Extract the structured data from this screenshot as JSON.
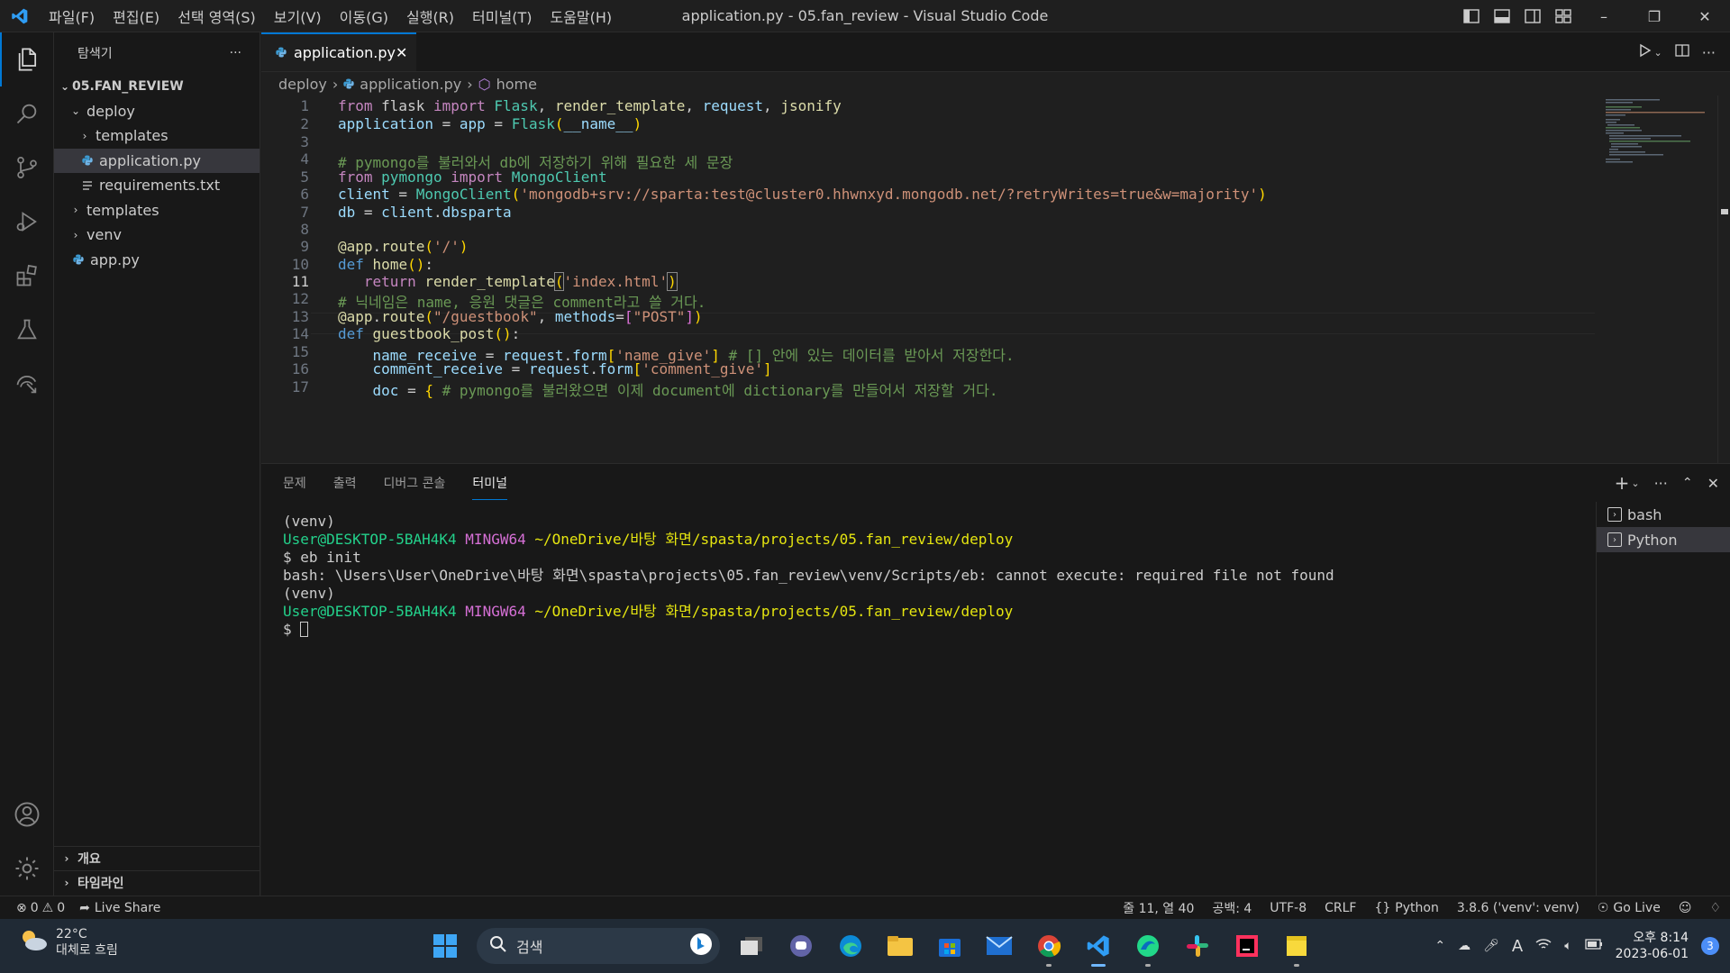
{
  "window": {
    "title": "application.py - 05.fan_review - Visual Studio Code",
    "menu": [
      "파일(F)",
      "편집(E)",
      "선택 영역(S)",
      "보기(V)",
      "이동(G)",
      "실행(R)",
      "터미널(T)",
      "도움말(H)"
    ]
  },
  "sidebar": {
    "header": "탐색기",
    "more": "···",
    "tree": [
      {
        "label": "05.FAN_REVIEW",
        "chev": "⌄",
        "icon": ""
      },
      {
        "label": "deploy",
        "chev": "⌄",
        "icon": ""
      },
      {
        "label": "templates",
        "chev": "›",
        "icon": ""
      },
      {
        "label": "application.py",
        "chev": "",
        "icon": "python-file-icon"
      },
      {
        "label": "requirements.txt",
        "chev": "",
        "icon": "text-file-icon"
      },
      {
        "label": "templates",
        "chev": "›",
        "icon": ""
      },
      {
        "label": "venv",
        "chev": "›",
        "icon": ""
      },
      {
        "label": "app.py",
        "chev": "",
        "icon": "python-file-icon"
      }
    ],
    "outline": "개요",
    "timeline": "타임라인"
  },
  "editor": {
    "tab_label": "application.py",
    "breadcrumb": [
      "deploy",
      "application.py",
      "home"
    ],
    "current_line": 11,
    "line_numbers": [
      "1",
      "2",
      "3",
      "4",
      "5",
      "6",
      "7",
      "8",
      "9",
      "10",
      "11",
      "12",
      "13",
      "14",
      "15",
      "16",
      "17"
    ]
  },
  "panel": {
    "tabs": [
      "문제",
      "출력",
      "디버그 콘솔",
      "터미널"
    ],
    "active_tab": "터미널",
    "terminal_lines": [
      {
        "parts": [
          {
            "t": "(venv)",
            "c": ""
          }
        ]
      },
      {
        "parts": [
          {
            "t": "User@DESKTOP-5BAH4K4 ",
            "c": "tg"
          },
          {
            "t": "MINGW64 ",
            "c": "tm"
          },
          {
            "t": "~/OneDrive/바탕 화면/spasta/projects/05.fan_review/deploy",
            "c": "ty"
          }
        ]
      },
      {
        "parts": [
          {
            "t": "$ eb init",
            "c": ""
          }
        ]
      },
      {
        "parts": [
          {
            "t": "bash: \\Users\\User\\OneDrive\\바탕 화면\\spasta\\projects\\05.fan_review\\venv/Scripts/eb: cannot execute: required file not found",
            "c": ""
          }
        ]
      },
      {
        "parts": [
          {
            "t": "(venv)",
            "c": ""
          }
        ]
      },
      {
        "parts": [
          {
            "t": "User@DESKTOP-5BAH4K4 ",
            "c": "tg"
          },
          {
            "t": "MINGW64 ",
            "c": "tm"
          },
          {
            "t": "~/OneDrive/바탕 화면/spasta/projects/05.fan_review/deploy",
            "c": "ty"
          }
        ]
      },
      {
        "parts": [
          {
            "t": "$ ",
            "c": ""
          }
        ]
      }
    ],
    "terminals": [
      "bash",
      "Python"
    ]
  },
  "statusbar": {
    "errors": "0",
    "warnings": "0",
    "live_share": "Live Share",
    "position": "줄 11, 열 40",
    "spaces": "공백: 4",
    "encoding": "UTF-8",
    "eol": "CRLF",
    "language": "Python",
    "interpreter": "3.8.6 ('venv': venv)",
    "go_live": "Go Live"
  },
  "taskbar": {
    "temp": "22°C",
    "weather": "대체로 흐림",
    "search_placeholder": "검색",
    "time": "오후 8:14",
    "date": "2023-06-01",
    "notifications": "3"
  },
  "colors": {
    "accent": "#0078d4",
    "editor_bg": "#1f1f1f",
    "taskbar_bg": "#202a35"
  }
}
